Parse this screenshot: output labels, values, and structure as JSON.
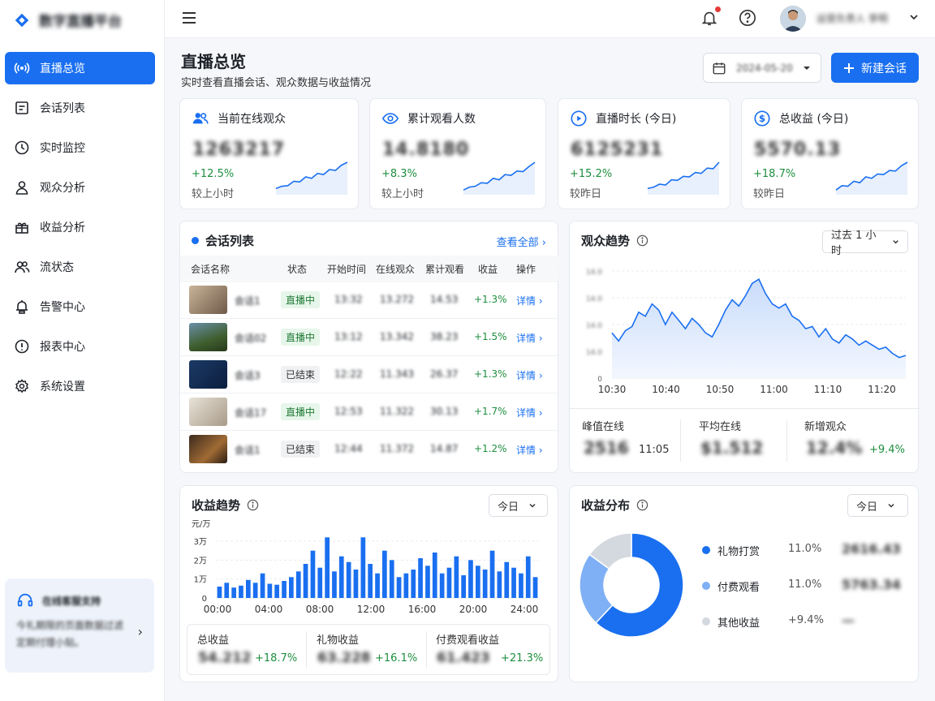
{
  "app": {
    "name": "数字直播平台"
  },
  "sidebar": {
    "items": [
      {
        "label": "直播总览",
        "icon": "broadcast-icon",
        "active": true
      },
      {
        "label": "会话列表",
        "icon": "list-icon"
      },
      {
        "label": "实时监控",
        "icon": "clock-icon"
      },
      {
        "label": "观众分析",
        "icon": "user-icon"
      },
      {
        "label": "收益分析",
        "icon": "gift-icon"
      },
      {
        "label": "流状态",
        "icon": "users-icon"
      },
      {
        "label": "告警中心",
        "icon": "bell-outline-icon"
      },
      {
        "label": "报表中心",
        "icon": "report-icon"
      },
      {
        "label": "系统设置",
        "icon": "gear-icon"
      }
    ],
    "support": {
      "title": "在线客服支持",
      "text": "今礼期限的页面数据过滤定期付理小贴。"
    }
  },
  "topbar": {
    "user_name": "运营负责人 李明"
  },
  "header": {
    "title": "直播总览",
    "subtitle": "实时查看直播会话、观众数据与收益情况",
    "date_value": "2024-05-20",
    "new_button": "新建会话"
  },
  "kpis": [
    {
      "title": "当前在线观众",
      "icon": "users-icon",
      "value": "1263217",
      "change": "+12.5%",
      "compare": "较上小时",
      "trend": [
        0.1,
        0.18,
        0.2,
        0.35,
        0.33,
        0.5,
        0.45,
        0.62,
        0.58,
        0.75,
        0.72,
        0.9,
        1.0
      ]
    },
    {
      "title": "累计观看人数",
      "icon": "eye-icon",
      "value": "14.8180",
      "change": "+8.3%",
      "compare": "较上小时",
      "trend": [
        0.05,
        0.15,
        0.18,
        0.3,
        0.28,
        0.45,
        0.4,
        0.58,
        0.55,
        0.7,
        0.68,
        0.85,
        1.0
      ]
    },
    {
      "title": "直播时长 (今日)",
      "icon": "play-icon",
      "value": "6125231",
      "change": "+15.2%",
      "compare": "较昨日",
      "trend": [
        0.1,
        0.15,
        0.25,
        0.22,
        0.4,
        0.38,
        0.52,
        0.5,
        0.65,
        0.62,
        0.8,
        0.78,
        1.0
      ]
    },
    {
      "title": "总收益 (今日)",
      "icon": "dollar-icon",
      "value": "5570.13",
      "change": "+18.7%",
      "compare": "较昨日",
      "trend": [
        0.05,
        0.2,
        0.18,
        0.35,
        0.3,
        0.5,
        0.45,
        0.6,
        0.58,
        0.72,
        0.7,
        0.88,
        1.0
      ]
    }
  ],
  "sessions": {
    "title": "会话列表",
    "view_all": "查看全部",
    "columns": [
      "会话名称",
      "状态",
      "开始时间",
      "在线观众",
      "累计观看",
      "收益",
      "操作"
    ],
    "rows": [
      {
        "name": "会话1",
        "status": "直播中",
        "start": "13:32",
        "online": "13.272",
        "total": "14.53",
        "revenue": "+1.3%",
        "action": "详情"
      },
      {
        "name": "会话02",
        "status": "直播中",
        "start": "13:12",
        "online": "13.342",
        "total": "38.23",
        "revenue": "+1.5%",
        "action": "详情"
      },
      {
        "name": "会话3",
        "status": "已结束",
        "start": "12:22",
        "online": "11.343",
        "total": "26.37",
        "revenue": "+1.3%",
        "action": "详情"
      },
      {
        "name": "会话17",
        "status": "直播中",
        "start": "12:53",
        "online": "11.322",
        "total": "30.13",
        "revenue": "+1.7%",
        "action": "详情"
      },
      {
        "name": "会话1",
        "status": "已结束",
        "start": "12:44",
        "online": "11.372",
        "total": "14.87",
        "revenue": "+1.2%",
        "action": "详情"
      }
    ]
  },
  "audience": {
    "title": "观众趋势",
    "range": "过去 1 小时",
    "peak_label": "峰值在线",
    "peak_value": "2516",
    "peak_time": "11:05",
    "avg_label": "平均在线",
    "avg_value": "$1.512",
    "new_label": "新增观众",
    "new_value": "12.4%",
    "new_change": "+9.4%"
  },
  "revenue_trend": {
    "title": "收益趋势",
    "range": "今日",
    "total_label": "总收益",
    "total_value": "54.212",
    "total_change": "+18.7%",
    "gift_label": "礼物收益",
    "gift_value": "63.228",
    "gift_change": "+16.1%",
    "paid_label": "付费观看收益",
    "paid_value": "61.423",
    "paid_change": "+21.3%"
  },
  "revenue_dist": {
    "title": "收益分布",
    "range": "今日",
    "items": [
      {
        "label": "礼物打赏",
        "pct": "11.0%",
        "amount": "2616.43",
        "color": "#1a6ff0"
      },
      {
        "label": "付费观看",
        "pct": "11.0%",
        "amount": "5763.34",
        "color": "#7fb0f5"
      },
      {
        "label": "其他收益",
        "pct": "+9.4%",
        "amount": "—",
        "color": "#d4d8df"
      }
    ]
  },
  "chart_data": [
    {
      "type": "area",
      "title": "观众趋势",
      "x_ticks": [
        "10:30",
        "10:40",
        "10:50",
        "11:00",
        "11:10",
        "11:20"
      ],
      "y_ticks": [
        "0",
        "14.0",
        "14.0",
        "14.0",
        "14.0"
      ],
      "series": [
        {
          "values": [
            2.2,
            1.8,
            2.3,
            2.5,
            3.2,
            3.0,
            3.6,
            3.3,
            2.6,
            3.2,
            2.8,
            2.4,
            2.9,
            2.6,
            2.2,
            2.0,
            2.6,
            3.3,
            3.8,
            3.5,
            4.0,
            4.6,
            4.8,
            4.1,
            3.6,
            3.4,
            3.6,
            3.0,
            2.8,
            2.4,
            2.5,
            2.0,
            2.4,
            1.9,
            1.7,
            2.1,
            1.9,
            1.6,
            1.8,
            1.6,
            1.4,
            1.5,
            1.2,
            1.0,
            1.1
          ]
        }
      ]
    },
    {
      "type": "bar",
      "title": "收益趋势",
      "y_unit": "元/万",
      "y_ticks": [
        "0",
        "1万",
        "2万",
        "3万"
      ],
      "x_ticks": [
        "00:00",
        "04:00",
        "08:00",
        "12:00",
        "16:00",
        "20:00",
        "24:00"
      ],
      "ylim": [
        0,
        3.5
      ],
      "values": [
        0.6,
        0.8,
        0.55,
        0.65,
        0.95,
        0.8,
        1.3,
        0.75,
        0.7,
        0.9,
        1.1,
        1.4,
        1.8,
        2.5,
        1.6,
        3.2,
        1.4,
        2.2,
        1.9,
        1.5,
        3.2,
        1.8,
        1.3,
        2.5,
        2.0,
        1.1,
        1.3,
        1.5,
        2.1,
        1.7,
        2.4,
        1.3,
        1.6,
        2.2,
        1.2,
        2.0,
        1.7,
        1.5,
        2.5,
        1.4,
        1.9,
        1.6,
        1.3,
        2.2,
        1.1
      ]
    },
    {
      "type": "pie",
      "title": "收益分布",
      "categories": [
        "礼物打赏",
        "付费观看",
        "其他收益"
      ],
      "values": [
        62,
        23,
        15
      ]
    }
  ]
}
